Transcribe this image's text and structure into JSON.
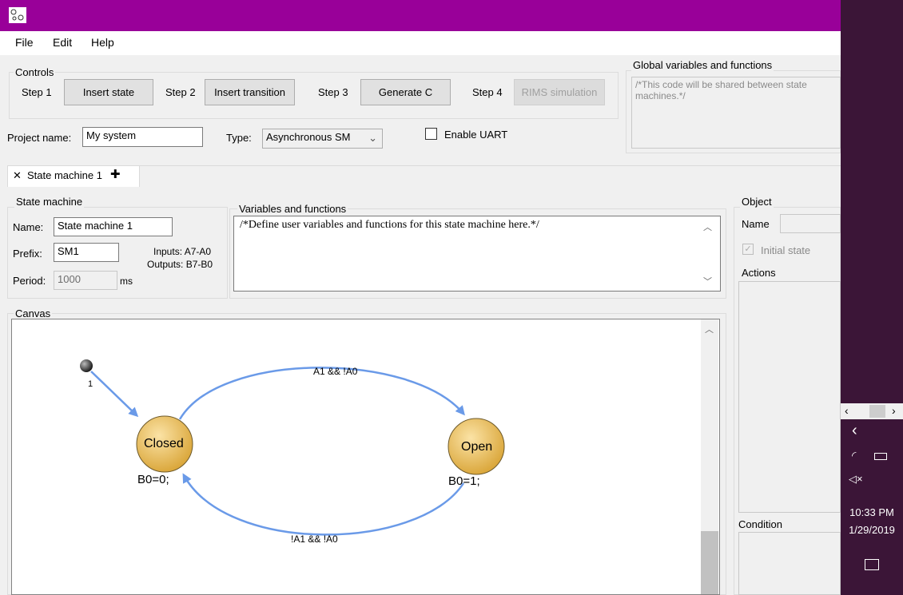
{
  "menu": [
    "File",
    "Edit",
    "Help"
  ],
  "controls": {
    "title": "Controls",
    "step1": "Step 1",
    "insert_state": "Insert state",
    "step2": "Step 2",
    "insert_transition": "Insert transition",
    "step3": "Step 3",
    "generate_c": "Generate C",
    "step4": "Step 4",
    "rims_simulation": "RIMS simulation"
  },
  "project": {
    "name_label": "Project name:",
    "name_value": "My system",
    "type_label": "Type:",
    "type_value": "Asynchronous SM",
    "uart_label": "Enable UART"
  },
  "global": {
    "title": "Global variables and functions",
    "code": "/*This code will be shared between state machines.*/"
  },
  "tabs": {
    "active": "State machine 1"
  },
  "state_machine": {
    "title": "State machine",
    "name_label": "Name:",
    "name_value": "State machine 1",
    "prefix_label": "Prefix:",
    "prefix_value": "SM1",
    "period_label": "Period:",
    "period_value": "1000",
    "period_unit": "ms",
    "inputs": "Inputs: A7-A0",
    "outputs": "Outputs: B7-B0"
  },
  "variables": {
    "title": "Variables and functions",
    "code": "/*Define user variables and functions for this state machine here.*/"
  },
  "object": {
    "title": "Object",
    "name_label": "Name",
    "initial_state": "Initial state",
    "actions": "Actions",
    "condition": "Condition"
  },
  "canvas": {
    "title": "Canvas",
    "init_label": "1",
    "states": [
      {
        "name": "Closed",
        "action": "B0=0;"
      },
      {
        "name": "Open",
        "action": "B0=1;"
      }
    ],
    "transitions": [
      {
        "label": "A1 && !A0"
      },
      {
        "label": "!A1 && !A0"
      }
    ]
  },
  "tray": {
    "time": "10:33 PM",
    "date": "1/29/2019"
  },
  "colors": {
    "titlebar": "#990099",
    "state_fill": "#e8b040",
    "arrow": "#6a9ae8"
  }
}
